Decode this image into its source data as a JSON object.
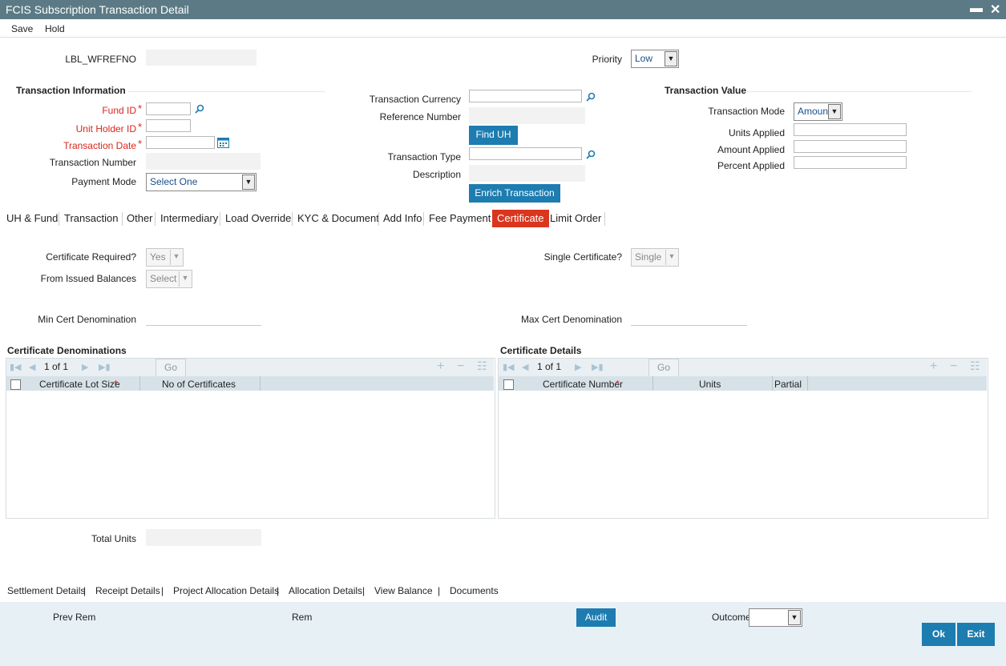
{
  "window": {
    "title": "FCIS Subscription Transaction Detail",
    "minimize": "▬",
    "close": "✕"
  },
  "menu": {
    "save": "Save",
    "hold": "Hold"
  },
  "header": {
    "wfrefno_label": "LBL_WFREFNO",
    "priority_label": "Priority",
    "priority_value": "Low"
  },
  "txn_info": {
    "title": "Transaction Information",
    "fund_id": "Fund ID",
    "unit_holder_id": "Unit Holder ID",
    "transaction_date": "Transaction Date",
    "transaction_number": "Transaction Number",
    "payment_mode": "Payment Mode",
    "payment_mode_value": "Select One",
    "required_mark": "*"
  },
  "middle": {
    "transaction_currency": "Transaction Currency",
    "reference_number": "Reference Number",
    "find_uh": "Find UH",
    "transaction_type": "Transaction Type",
    "description": "Description",
    "enrich": "Enrich Transaction"
  },
  "txn_value": {
    "title": "Transaction Value",
    "mode_label": "Transaction Mode",
    "mode_value": "Amount",
    "units_applied": "Units Applied",
    "amount_applied": "Amount Applied",
    "percent_applied": "Percent Applied"
  },
  "tabs": [
    "UH & Fund",
    "Transaction",
    "Other",
    "Intermediary",
    "Load Override",
    "KYC & Document",
    "Add Info",
    "Fee Payment",
    "Certificate",
    "Limit Order"
  ],
  "certificate": {
    "cert_required_label": "Certificate Required?",
    "cert_required_value": "Yes",
    "from_issued_label": "From Issued Balances",
    "from_issued_value": "Select",
    "single_cert_label": "Single Certificate?",
    "single_cert_value": "Single",
    "min_cert_label": "Min Cert Denomination",
    "max_cert_label": "Max Cert Denomination"
  },
  "denominations": {
    "title": "Certificate Denominations",
    "page": "1 of 1",
    "go": "Go",
    "col1": "Certificate Lot Size",
    "col2": "No of Certificates"
  },
  "details": {
    "title": "Certificate Details",
    "page": "1 of 1",
    "go": "Go",
    "col1": "Certificate Number",
    "col2": "Units",
    "col3": "Partial"
  },
  "total_units_label": "Total Units",
  "links": [
    "Settlement Details",
    "Receipt Details",
    "Project Allocation Details",
    "Allocation Details",
    "View Balance",
    "Documents"
  ],
  "link_sep": "|",
  "footer": {
    "prev_rem": "Prev Rem",
    "rem": "Rem",
    "audit": "Audit",
    "outcome": "Outcome",
    "ok": "Ok",
    "exit": "Exit"
  },
  "icons": {
    "lov": "magnifier-icon",
    "calendar": "calendar-icon",
    "dropdown": "▼",
    "grid_add": "+",
    "grid_remove": "−",
    "grid_view": "☷"
  },
  "colors": {
    "titlebar": "#5b7a86",
    "accent": "#1d7cb0",
    "active_tab": "#d9361f",
    "required": "#d9261c"
  }
}
